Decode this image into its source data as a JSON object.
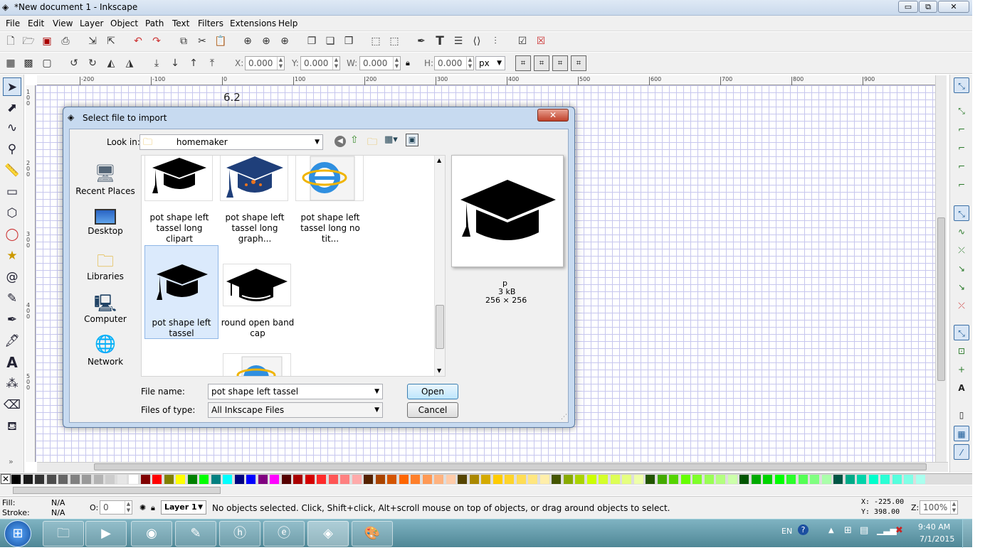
{
  "window": {
    "title": "*New document 1 - Inkscape",
    "minimize": "▭",
    "restore": "⧉",
    "close": "✕"
  },
  "menu": [
    "File",
    "Edit",
    "View",
    "Layer",
    "Object",
    "Path",
    "Text",
    "Filters",
    "Extensions",
    "Help"
  ],
  "selector_toolbar": {
    "x_label": "X:",
    "x_value": "0.000",
    "y_label": "Y:",
    "y_value": "0.000",
    "w_label": "W:",
    "w_value": "0.000",
    "h_label": "H:",
    "h_value": "0.000",
    "unit": "px"
  },
  "ruler": {
    "h_ticks": [
      "-200",
      "-100",
      "0",
      "100",
      "200",
      "300",
      "400",
      "500",
      "600",
      "700",
      "800",
      "900"
    ]
  },
  "canvas": {
    "label": "6.2"
  },
  "dialog": {
    "title": "Select file to import",
    "close": "✕",
    "look_in_label": "Look in:",
    "look_in_value": "homemaker",
    "places": [
      "Recent Places",
      "Desktop",
      "Libraries",
      "Computer",
      "Network"
    ],
    "files": [
      {
        "caption_line1": "pot shape left",
        "caption_line2": "tassel long clipart",
        "icon": "graduation-cap-icon"
      },
      {
        "caption_line1": "pot shape left",
        "caption_line2": "tassel long graph...",
        "icon": "graduation-cap-blue-icon"
      },
      {
        "caption_line1": "pot shape left",
        "caption_line2": "tassel long no tit...",
        "icon": "internet-explorer-icon"
      },
      {
        "caption_line1": "pot shape left",
        "caption_line2": "tassel",
        "icon": "graduation-cap-icon"
      },
      {
        "caption_line1": "round open band",
        "caption_line2": "cap",
        "icon": "graduation-cap-icon"
      }
    ],
    "preview": {
      "name": "p",
      "size": "3 kB",
      "dimensions": "256 × 256"
    },
    "file_name_label": "File name:",
    "file_name_value": "pot shape left tassel",
    "files_of_type_label": "Files of type:",
    "files_of_type_value": "All Inkscape Files",
    "open_label": "Open",
    "cancel_label": "Cancel"
  },
  "status": {
    "fill_label": "Fill:",
    "fill_value": "N/A",
    "stroke_label": "Stroke:",
    "stroke_value": "N/A",
    "opacity_label": "O:",
    "opacity_value": "0",
    "layer": "Layer 1",
    "message": "No objects selected. Click, Shift+click, Alt+scroll mouse on top of objects, or drag around objects to select.",
    "x_coord": "X: -225.00",
    "y_coord": "Y:  398.00",
    "zoom_label": "Z:",
    "zoom_value": "100%"
  },
  "taskbar": {
    "lang": "EN",
    "time": "9:40 AM",
    "date": "7/1/2015"
  },
  "colors": {
    "accent": "#3a6ea5",
    "palette": [
      "#000000",
      "#1a1a1a",
      "#333333",
      "#4d4d4d",
      "#666666",
      "#808080",
      "#999999",
      "#b3b3b3",
      "#cccccc",
      "#e6e6e6",
      "#ffffff",
      "#800000",
      "#ff0000",
      "#808000",
      "#ffff00",
      "#008000",
      "#00ff00",
      "#008080",
      "#00ffff",
      "#000080",
      "#0000ff",
      "#800080",
      "#ff00ff",
      "#550000",
      "#aa0000",
      "#d40000",
      "#ff2a2a",
      "#ff5555",
      "#ff8080",
      "#ffaaaa",
      "#552200",
      "#aa4400",
      "#d45500",
      "#ff6600",
      "#ff7f2a",
      "#ff9955",
      "#ffb380",
      "#ffccaa",
      "#554400",
      "#aa8800",
      "#d4aa00",
      "#ffcc00",
      "#ffd42a",
      "#ffdd55",
      "#ffe680",
      "#ffeeaa",
      "#445500",
      "#88aa00",
      "#aad400",
      "#ccff00",
      "#d4ff2a",
      "#ddff55",
      "#e5ff80",
      "#eeffaa",
      "#225500",
      "#44aa00",
      "#55d400",
      "#66ff00",
      "#7fff2a",
      "#99ff55",
      "#b3ff80",
      "#ccffaa",
      "#005500",
      "#00aa00",
      "#00d400",
      "#00ff00",
      "#2aff2a",
      "#55ff55",
      "#80ff80",
      "#aaffaa",
      "#005544",
      "#00aa88",
      "#00d4aa",
      "#00ffcc",
      "#2affd5",
      "#55ffdd",
      "#80ffe6",
      "#aaffee"
    ]
  }
}
